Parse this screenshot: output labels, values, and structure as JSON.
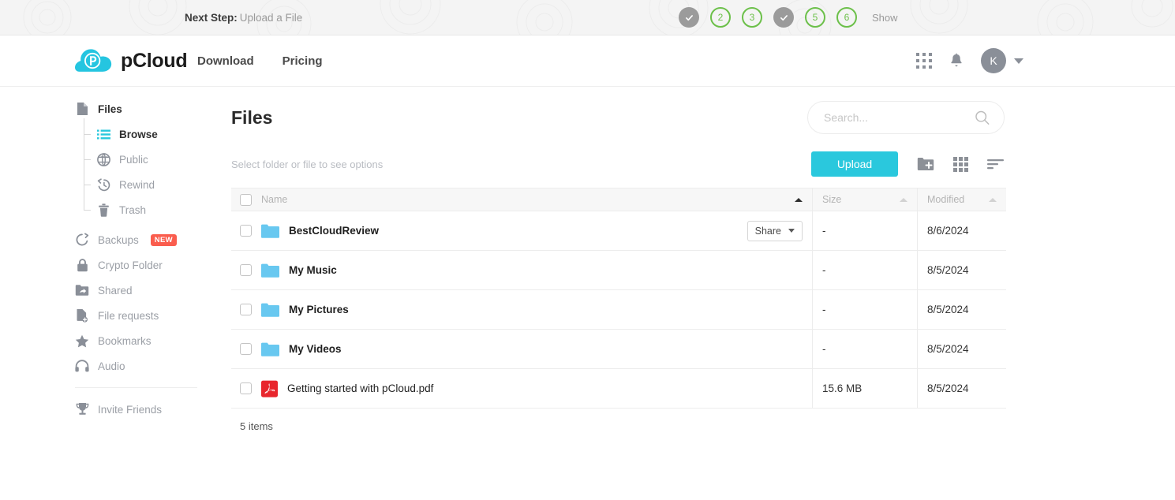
{
  "onboarding": {
    "next_step_label": "Next Step:",
    "next_step_value": "Upload a File",
    "show_label": "Show",
    "steps": [
      {
        "state": "done",
        "label": ""
      },
      {
        "state": "todo",
        "label": "2"
      },
      {
        "state": "todo",
        "label": "3"
      },
      {
        "state": "done",
        "label": ""
      },
      {
        "state": "todo",
        "label": "5"
      },
      {
        "state": "todo",
        "label": "6"
      }
    ],
    "colors": {
      "done_fill": "#9b9b9b",
      "todo_stroke": "#6cc04a"
    }
  },
  "header": {
    "brand": "pCloud",
    "nav": [
      {
        "label": "Download"
      },
      {
        "label": "Pricing"
      }
    ],
    "apps_icon": "apps-grid-icon",
    "notifications_icon": "bell-icon",
    "avatar_initial": "K",
    "brand_color": "#2ac8dd"
  },
  "sidebar": {
    "items": [
      {
        "label": "Files",
        "icon": "file-icon",
        "active": true,
        "sub": false
      },
      {
        "label": "Browse",
        "icon": "list-icon",
        "active": true,
        "sub": true
      },
      {
        "label": "Public",
        "icon": "globe-icon",
        "active": false,
        "sub": true
      },
      {
        "label": "Rewind",
        "icon": "history-icon",
        "active": false,
        "sub": true
      },
      {
        "label": "Trash",
        "icon": "trash-icon",
        "active": false,
        "sub": true
      },
      {
        "label": "Backups",
        "icon": "backup-icon",
        "active": false,
        "sub": false,
        "badge": "NEW"
      },
      {
        "label": "Crypto Folder",
        "icon": "lock-icon",
        "active": false,
        "sub": false
      },
      {
        "label": "Shared",
        "icon": "shared-folder-icon",
        "active": false,
        "sub": false
      },
      {
        "label": "File requests",
        "icon": "file-request-icon",
        "active": false,
        "sub": false
      },
      {
        "label": "Bookmarks",
        "icon": "star-icon",
        "active": false,
        "sub": false
      },
      {
        "label": "Audio",
        "icon": "headphones-icon",
        "active": false,
        "sub": false
      },
      {
        "label": "Invite Friends",
        "icon": "trophy-icon",
        "active": false,
        "sub": false
      }
    ],
    "badge_color": "#fa5d4e"
  },
  "main": {
    "page_title": "Files",
    "search_placeholder": "Search...",
    "search_value": "",
    "toolbar_hint": "Select folder or file to see options",
    "upload_label": "Upload",
    "new_folder_icon": "new-folder-icon",
    "grid_view_icon": "grid-view-icon",
    "sort_icon": "sort-icon",
    "columns": {
      "name": "Name",
      "size": "Size",
      "modified": "Modified"
    },
    "rows": [
      {
        "name": "BestCloudReview",
        "type": "folder",
        "bold": true,
        "size": "-",
        "modified": "8/6/2024",
        "share_label": "Share",
        "has_share": true
      },
      {
        "name": "My Music",
        "type": "folder",
        "bold": true,
        "size": "-",
        "modified": "8/5/2024",
        "has_share": false
      },
      {
        "name": "My Pictures",
        "type": "folder",
        "bold": true,
        "size": "-",
        "modified": "8/5/2024",
        "has_share": false
      },
      {
        "name": "My Videos",
        "type": "folder",
        "bold": true,
        "size": "-",
        "modified": "8/5/2024",
        "has_share": false
      },
      {
        "name": "Getting started with pCloud.pdf",
        "type": "pdf",
        "bold": false,
        "size": "15.6 MB",
        "modified": "8/5/2024",
        "has_share": false
      }
    ],
    "items_count": "5 items",
    "folder_color": "#68c8f0",
    "pdf_color": "#e8262d"
  }
}
